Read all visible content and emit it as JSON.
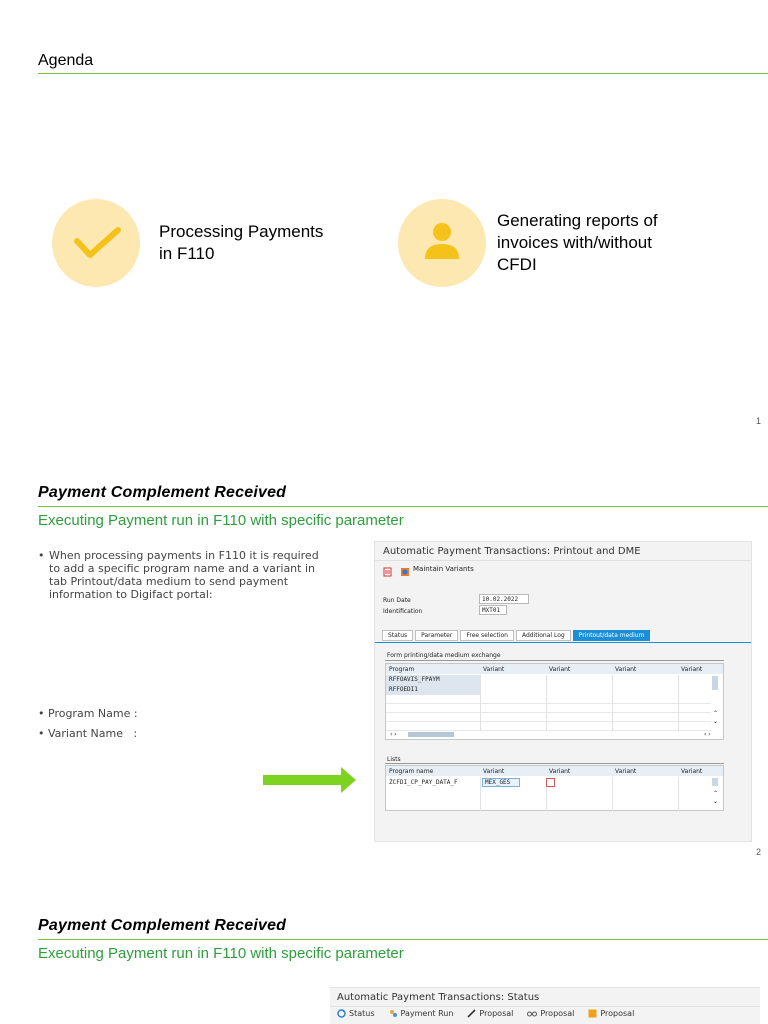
{
  "slide1": {
    "title": "Agenda",
    "items": [
      {
        "icon": "checkmark-icon",
        "text_line1": "Processing Payments",
        "text_line2": "in F110"
      },
      {
        "icon": "person-icon",
        "text_line1": "Generating reports of",
        "text_line2": "invoices with/without",
        "text_line3": "CFDI"
      }
    ],
    "page_number": "1",
    "colors": {
      "accent_green": "#7bc043",
      "circle_bg": "#fde8b2",
      "icon_yellow": "#f5c21b"
    }
  },
  "slide2": {
    "title": "Payment Complement Received",
    "subtitle": "Executing Payment run in F110 with specific parameter",
    "paragraph_line1": "When processing payments in F110 it is required",
    "paragraph_line2": "to add a specific program name and a variant in",
    "paragraph_line3": "tab Printout/data medium to send payment",
    "paragraph_line4": "information to Digifact portal:",
    "program_name_label": "Program Name :",
    "variant_name_label": "Variant Name   :",
    "page_number": "2",
    "sap": {
      "window_title": "Automatic Payment Transactions: Printout and DME",
      "maintain_variants": "Maintain Variants",
      "run_date_label": "Run Date",
      "run_date_value": "10.02.2022",
      "identification_label": "Identification",
      "identification_value": "MXT01",
      "tabs": [
        "Status",
        "Parameter",
        "Free selection",
        "Additional Log",
        "Printout/data medium"
      ],
      "section1_title": "Form printing/data medium exchange",
      "section1_cols": [
        "Program",
        "Variant",
        "Variant",
        "Variant",
        "Variant"
      ],
      "section1_rows": [
        "RFFOAVIS_FPAYM",
        "RFFOEDI1"
      ],
      "section2_title": "Lists",
      "section2_cols": [
        "Program name",
        "Variant",
        "Variant",
        "Variant",
        "Variant"
      ],
      "section2_row_program": "ZCFDI_CP_PAY_DATA_F",
      "section2_row_variant": "MEX_GES"
    }
  },
  "slide3": {
    "title": "Payment Complement Received",
    "subtitle": "Executing Payment run in F110 with specific parameter",
    "sap": {
      "window_title": "Automatic Payment Transactions: Status",
      "toolbar": [
        "Status",
        "Payment Run",
        "Proposal",
        "Proposal",
        "Proposal"
      ]
    }
  }
}
